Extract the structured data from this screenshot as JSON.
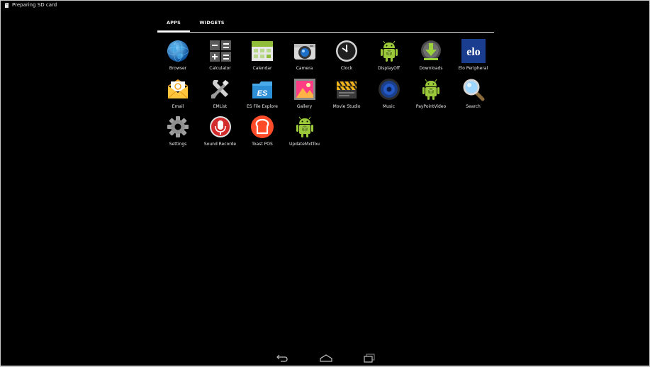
{
  "status_bar": {
    "text": "Preparing SD card",
    "icon": "sd-card-icon"
  },
  "tabs": [
    {
      "label": "APPS",
      "active": true
    },
    {
      "label": "WIDGETS",
      "active": false
    }
  ],
  "apps": [
    {
      "label": "Browser",
      "icon": "globe-icon"
    },
    {
      "label": "Calculator",
      "icon": "calculator-icon"
    },
    {
      "label": "Calendar",
      "icon": "calendar-icon"
    },
    {
      "label": "Camera",
      "icon": "camera-icon"
    },
    {
      "label": "Clock",
      "icon": "clock-icon"
    },
    {
      "label": "DisplayOff",
      "icon": "android-icon"
    },
    {
      "label": "Downloads",
      "icon": "download-icon"
    },
    {
      "label": "Elo Peripheral",
      "icon": "elo-logo-icon",
      "logo_text": "elo"
    },
    {
      "label": "Email",
      "icon": "envelope-icon"
    },
    {
      "label": "EMList",
      "icon": "tools-icon"
    },
    {
      "label": "ES File Explore",
      "icon": "es-folder-icon",
      "logo_text": "ES"
    },
    {
      "label": "Gallery",
      "icon": "gallery-icon"
    },
    {
      "label": "Movie Studio",
      "icon": "clapperboard-icon"
    },
    {
      "label": "Music",
      "icon": "speaker-icon"
    },
    {
      "label": "PayPointVideo",
      "icon": "android-icon"
    },
    {
      "label": "Search",
      "icon": "magnifier-icon"
    },
    {
      "label": "Settings",
      "icon": "gear-icon"
    },
    {
      "label": "Sound Recorde",
      "icon": "microphone-icon"
    },
    {
      "label": "Toast POS",
      "icon": "toast-logo-icon"
    },
    {
      "label": "UpdateMxtTou",
      "icon": "android-icon"
    }
  ],
  "nav_bar": [
    {
      "icon": "back-icon"
    },
    {
      "icon": "home-icon"
    },
    {
      "icon": "recents-icon"
    }
  ]
}
